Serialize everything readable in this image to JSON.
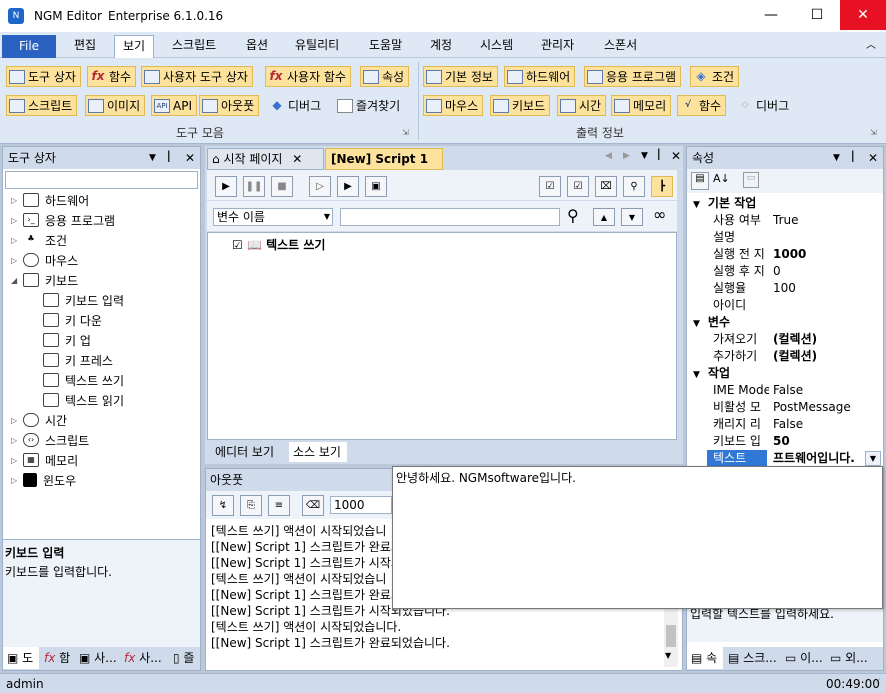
{
  "window": {
    "title": "NGM Editor",
    "version": "Enterprise 6.1.0.16",
    "min": "—",
    "max": "☐",
    "close": "✕"
  },
  "menu": [
    "File",
    "편집",
    "보기",
    "스크립트",
    "옵션",
    "유틸리티",
    "도움말",
    "계정",
    "시스템",
    "관리자",
    "스폰서"
  ],
  "ribbon": {
    "group1": {
      "label": "도구 모음",
      "row1": [
        "도구 상자",
        "함수",
        "사용자 도구 상자",
        "사용자 함수",
        "속성"
      ],
      "row2": [
        "스크립트",
        "이미지",
        "API",
        "아웃풋",
        "디버그",
        "즐겨찾기"
      ]
    },
    "group2": {
      "label": "출력 정보",
      "row1": [
        "기본 정보",
        "하드웨어",
        "응용 프로그램",
        "조건"
      ],
      "row2": [
        "마우스",
        "키보드",
        "시간",
        "메모리",
        "함수",
        "디버그"
      ]
    }
  },
  "toolbox": {
    "title": "도구 상자",
    "items": [
      "하드웨어",
      "응용 프로그램",
      "조건",
      "마우스",
      "키보드",
      "키보드 입력",
      "키 다운",
      "키 업",
      "키 프레스",
      "텍스트 쓰기",
      "텍스트 읽기",
      "시간",
      "스크립트",
      "메모리",
      "윈도우"
    ],
    "desc_title": "키보드 입력",
    "desc": "키보드를 입력합니다.",
    "bottom_tabs": [
      "도",
      "함",
      "사...",
      "사...",
      "즐"
    ]
  },
  "editor": {
    "tabs": [
      "시작 페이지",
      "[New] Script 1"
    ],
    "var_select": "변수 이름",
    "action": "텍스트 쓰기",
    "bottom_tabs": [
      "에디터 보기",
      "소스 보기"
    ]
  },
  "output": {
    "title": "아웃풋",
    "count": "1000",
    "lines": [
      "[텍스트 쓰기] 액션이 시작되었습니",
      "[[New] Script 1] 스크립트가 완료되",
      "[[New] Script 1] 스크립트가 시작되",
      "[텍스트 쓰기] 액션이 시작되었습니",
      "[[New] Script 1] 스크립트가 완료되",
      "[[New] Script 1] 스크립트가 시작되었습니다.",
      "[텍스트 쓰기] 액션이 시작되었습니다.",
      "[[New] Script 1] 스크립트가 완료되었습니다."
    ]
  },
  "popup": {
    "text": "안녕하세요. NGMsoftware입니다."
  },
  "properties": {
    "title": "속성",
    "sections": [
      {
        "name": "기본 작업",
        "rows": [
          [
            "사용 여부",
            "True"
          ],
          [
            "설명",
            ""
          ],
          [
            "실행 전 지",
            "1000"
          ],
          [
            "실행 후 지",
            "0"
          ],
          [
            "실행율",
            "100"
          ],
          [
            "아이디",
            ""
          ]
        ]
      },
      {
        "name": "변수",
        "rows": [
          [
            "가져오기",
            "(컬렉션)"
          ],
          [
            "추가하기",
            "(컬렉션)"
          ]
        ]
      },
      {
        "name": "작업",
        "rows": [
          [
            "IME Mode",
            "False"
          ],
          [
            "비활성 모",
            "PostMessage"
          ],
          [
            "캐리지 리",
            "False"
          ],
          [
            "키보드 입",
            "50"
          ],
          [
            "텍스트",
            "프트웨어입니다."
          ]
        ]
      }
    ],
    "desc": "입력할 텍스트를 입력하세요.",
    "bottom_tabs": [
      "속",
      "스크...",
      "이...",
      "외..."
    ]
  },
  "status": {
    "user": "admin",
    "time": "00:49:00"
  },
  "colors": {
    "accent": "#2b62c2",
    "ribbon_btn": "#fce29c",
    "selected": "#3178d6"
  }
}
